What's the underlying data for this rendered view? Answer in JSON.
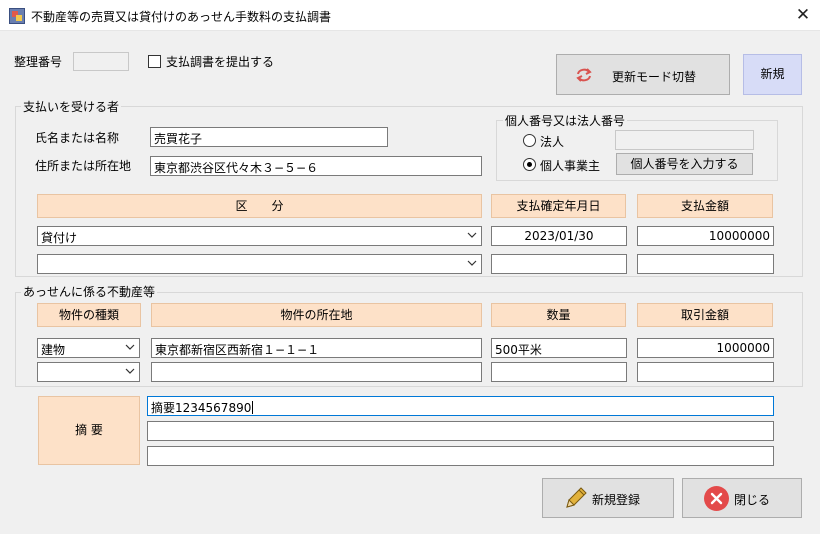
{
  "window": {
    "title": "不動産等の売買又は貸付けのあっせん手数料の支払調書",
    "close_glyph": "✕"
  },
  "top": {
    "seiri_label": "整理番号",
    "seiri_value": "",
    "submit_checkbox_label": "支払調書を提出する",
    "submit_checked": false,
    "mode_button_label": "更新モード切替",
    "mode_badge": "新規"
  },
  "payee": {
    "group_title": "支払いを受ける者",
    "name_label": "氏名または名称",
    "name_value": "売買花子",
    "address_label": "住所または所在地",
    "address_value": "東京都渋谷区代々木３−５−６",
    "id_group_title": "個人番号又は法人番号",
    "corp_label": "法人",
    "corp_selected": false,
    "corp_number": "",
    "individual_label": "個人事業主",
    "individual_selected": true,
    "enter_number_button": "個人番号を入力する",
    "headers": {
      "category": "区　　分",
      "date": "支払確定年月日",
      "amount": "支払金額"
    },
    "rows": [
      {
        "category": "貸付け",
        "date": "2023/01/30",
        "amount": "10000000"
      },
      {
        "category": "",
        "date": "",
        "amount": ""
      }
    ]
  },
  "property": {
    "group_title": "あっせんに係る不動産等",
    "headers": {
      "type": "物件の種類",
      "location": "物件の所在地",
      "quantity": "数量",
      "price": "取引金額"
    },
    "rows": [
      {
        "type": "建物",
        "location": "東京都新宿区西新宿１−１−１",
        "quantity": "500平米",
        "price": "1000000"
      },
      {
        "type": "",
        "location": "",
        "quantity": "",
        "price": ""
      }
    ]
  },
  "summary": {
    "label": "摘 要",
    "lines": [
      "摘要1234567890",
      "",
      ""
    ]
  },
  "footer": {
    "register_button": "新規登録",
    "close_button": "閉じる"
  },
  "colors": {
    "header_bg": "#fde1c8",
    "mode_badge_bg": "#d7dcf7",
    "close_icon_red": "#e34a4a",
    "refresh_icon_red": "#d9534f"
  }
}
